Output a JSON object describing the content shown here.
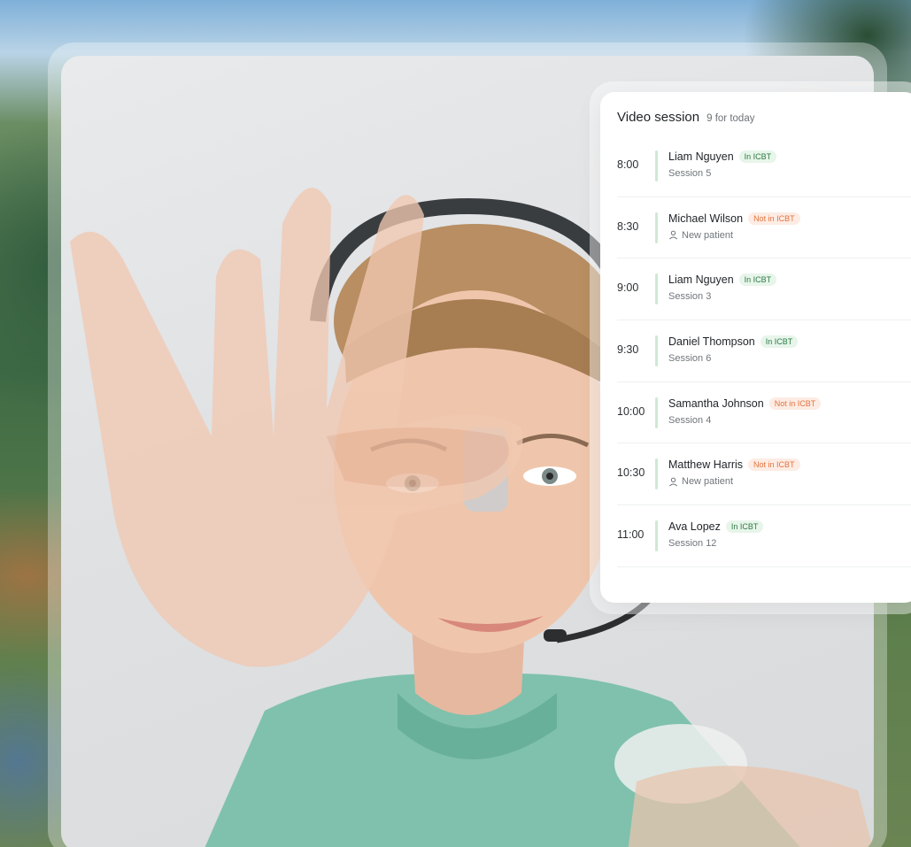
{
  "panel": {
    "title": "Video session",
    "count": "9 for today"
  },
  "sessions": [
    {
      "time": "8:00",
      "name": "Liam Nguyen",
      "badge": "In ICBT",
      "status": "in",
      "detail": "Session 5",
      "new_patient": false
    },
    {
      "time": "8:30",
      "name": "Michael Wilson",
      "badge": "Not in ICBT",
      "status": "out",
      "detail": "New patient",
      "new_patient": true
    },
    {
      "time": "9:00",
      "name": "Liam Nguyen",
      "badge": "In ICBT",
      "status": "in",
      "detail": "Session 3",
      "new_patient": false
    },
    {
      "time": "9:30",
      "name": "Daniel Thompson",
      "badge": "In ICBT",
      "status": "in",
      "detail": "Session 6",
      "new_patient": false
    },
    {
      "time": "10:00",
      "name": "Samantha Johnson",
      "badge": "Not in ICBT",
      "status": "out",
      "detail": "Session 4",
      "new_patient": false
    },
    {
      "time": "10:30",
      "name": "Matthew Harris",
      "badge": "Not in ICBT",
      "status": "out",
      "detail": "New patient",
      "new_patient": true
    },
    {
      "time": "11:00",
      "name": "Ava Lopez",
      "badge": "In ICBT",
      "status": "in",
      "detail": "Session 12",
      "new_patient": false
    }
  ],
  "controls": [
    {
      "name": "camera-button",
      "icon": "video-camera-icon"
    },
    {
      "name": "microphone-button",
      "icon": "microphone-icon"
    },
    {
      "name": "screen-share-button",
      "icon": "monitor-icon"
    },
    {
      "name": "chat-button",
      "icon": "chat-icon"
    },
    {
      "name": "end-call-button",
      "icon": "exit-door-icon"
    }
  ],
  "colors": {
    "end_call": "#e5433b",
    "in_icbt_bg": "#e7f5ea",
    "in_icbt_text": "#2f7a45",
    "not_in_icbt_bg": "#fdece4",
    "not_in_icbt_text": "#e2733d",
    "accent_bar": "#cfe9d4"
  }
}
